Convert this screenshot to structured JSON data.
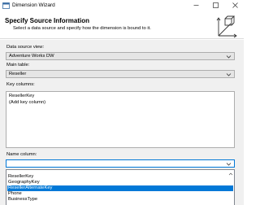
{
  "window": {
    "title": "Dimension Wizard",
    "minimize_icon": "minimize-icon",
    "maximize_icon": "maximize-icon",
    "close_icon": "close-icon"
  },
  "header": {
    "title": "Specify Source Information",
    "subtitle": "Select a data source and specify how the dimension is bound to it."
  },
  "form": {
    "data_source_view": {
      "label": "Data source view:",
      "value": "Adventure Works DW"
    },
    "main_table": {
      "label": "Main table:",
      "value": "Reseller"
    },
    "key_columns": {
      "label": "Key columns:",
      "rows": [
        "ResellerKey",
        "(Add key column)"
      ]
    },
    "name_column": {
      "label": "Name column:",
      "value": ""
    }
  },
  "dropdown": {
    "items": [
      "ResellerKey",
      "GeographyKey",
      "ResellerAlternateKey",
      "Phone",
      "BusinessType"
    ],
    "selected_index": 2
  },
  "colors": {
    "accent": "#0078d7",
    "panel_bg": "#f0f0f0",
    "combo_bg": "#e5e5e5"
  }
}
